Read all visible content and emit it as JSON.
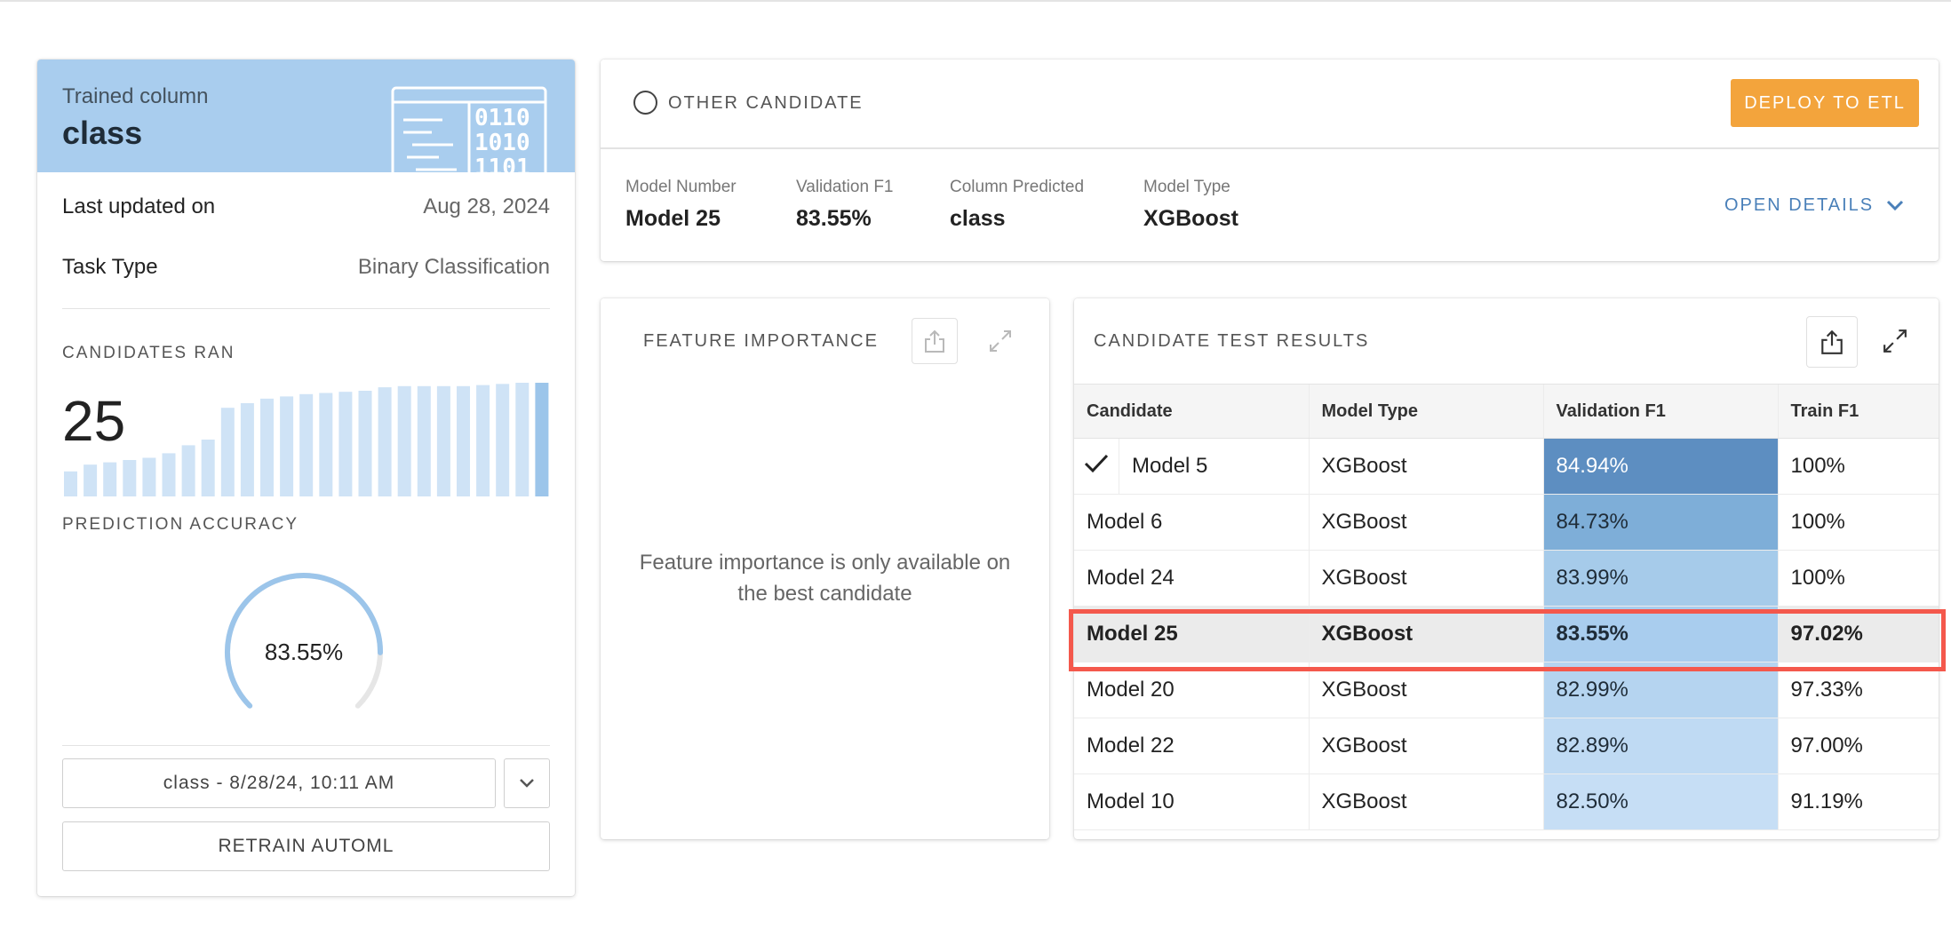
{
  "left_panel": {
    "trained_column_label": "Trained column",
    "trained_column_value": "class",
    "last_updated_label": "Last updated on",
    "last_updated_value": "Aug 28, 2024",
    "task_type_label": "Task Type",
    "task_type_value": "Binary Classification",
    "candidates_ran_title": "CANDIDATES RAN",
    "candidates_ran_count": "25",
    "candidate_bars": [
      0.22,
      0.28,
      0.3,
      0.32,
      0.34,
      0.38,
      0.45,
      0.5,
      0.78,
      0.82,
      0.86,
      0.88,
      0.9,
      0.91,
      0.92,
      0.93,
      0.96,
      0.97,
      0.97,
      0.97,
      0.97,
      0.98,
      0.99,
      1.0,
      1.0
    ],
    "prediction_accuracy_title": "PREDICTION ACCURACY",
    "prediction_accuracy_value": "83.55%",
    "prediction_accuracy_fraction": 0.8355,
    "version_select_value": "class - 8/28/24, 10:11 AM",
    "retrain_label": "RETRAIN AUTOML",
    "colors": {
      "header_bg": "#a9cdee",
      "bar_light": "#cfe3f6",
      "bar_selected": "#9cc5ea",
      "gauge_arc": "#9cc5ea",
      "gauge_track": "#e6e6e6"
    }
  },
  "candidate_card": {
    "other_candidate_label": "OTHER CANDIDATE",
    "deploy_label": "DEPLOY TO ETL",
    "open_details_label": "OPEN DETAILS",
    "meta": [
      {
        "label": "Model Number",
        "value": "Model 25"
      },
      {
        "label": "Validation F1",
        "value": "83.55%"
      },
      {
        "label": "Column Predicted",
        "value": "class"
      },
      {
        "label": "Model Type",
        "value": "XGBoost"
      }
    ],
    "colors": {
      "deploy_bg": "#f3a43c",
      "link": "#4a80b9"
    }
  },
  "feature_importance": {
    "title": "FEATURE IMPORTANCE",
    "message_line1": "Feature importance is only available on",
    "message_line2": "the best candidate"
  },
  "results": {
    "title": "CANDIDATE TEST RESULTS",
    "columns": [
      "Candidate",
      "Model Type",
      "Validation F1",
      "Train F1"
    ],
    "rows": [
      {
        "candidate": "Model 5",
        "model_type": "XGBoost",
        "validation_f1": "84.94%",
        "train_f1": "100%",
        "check": true,
        "cell_color": "#5d8ec1",
        "text_color": "#ffffff"
      },
      {
        "candidate": "Model 6",
        "model_type": "XGBoost",
        "validation_f1": "84.73%",
        "train_f1": "100%",
        "check": false,
        "cell_color": "#7eaed8",
        "text_color": "#1f2c38"
      },
      {
        "candidate": "Model 24",
        "model_type": "XGBoost",
        "validation_f1": "83.99%",
        "train_f1": "100%",
        "check": false,
        "cell_color": "#a6cbea",
        "text_color": "#1f2c38"
      },
      {
        "candidate": "Model 25",
        "model_type": "XGBoost",
        "validation_f1": "83.55%",
        "train_f1": "97.02%",
        "check": false,
        "cell_color": "#a9cdee",
        "text_color": "#1f2c38",
        "selected": true
      },
      {
        "candidate": "Model 20",
        "model_type": "XGBoost",
        "validation_f1": "82.99%",
        "train_f1": "97.33%",
        "check": false,
        "cell_color": "#b5d4f0",
        "text_color": "#1f2c38"
      },
      {
        "candidate": "Model 22",
        "model_type": "XGBoost",
        "validation_f1": "82.89%",
        "train_f1": "97.00%",
        "check": false,
        "cell_color": "#bfdaf3",
        "text_color": "#1f2c38"
      },
      {
        "candidate": "Model 10",
        "model_type": "XGBoost",
        "validation_f1": "82.50%",
        "train_f1": "91.19%",
        "check": false,
        "cell_color": "#c6def5",
        "text_color": "#1f2c38"
      }
    ],
    "highlight_color": "#f4584c"
  }
}
